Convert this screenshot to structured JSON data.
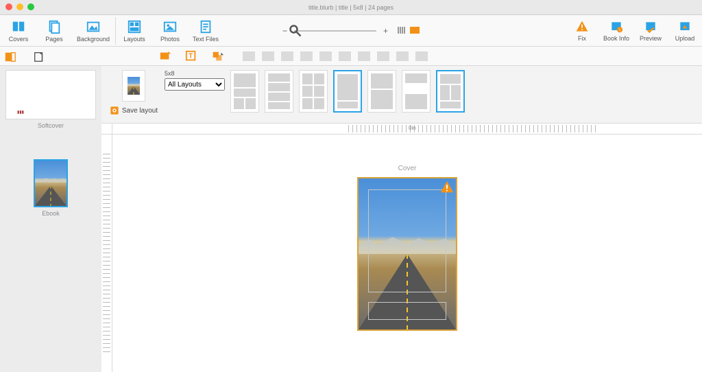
{
  "titlebar": {
    "text": "title.blurb | title | 5x8 | 24 pages"
  },
  "toolbar_left": {
    "covers": "Covers",
    "pages": "Pages",
    "background": "Background"
  },
  "toolbar_mid": {
    "layouts": "Layouts",
    "photos": "Photos",
    "textfiles": "Text Files"
  },
  "toolbar_right": {
    "fix": "Fix",
    "bookinfo": "Book Info",
    "preview": "Preview",
    "upload": "Upload"
  },
  "left_panel": {
    "softcover": "Softcover",
    "ebook": "Ebook"
  },
  "layout_strip": {
    "size_label": "5x8",
    "dropdown_value": "All Layouts",
    "save_layout": "Save layout"
  },
  "canvas": {
    "label": "Cover",
    "ruler_zero": "0in"
  }
}
